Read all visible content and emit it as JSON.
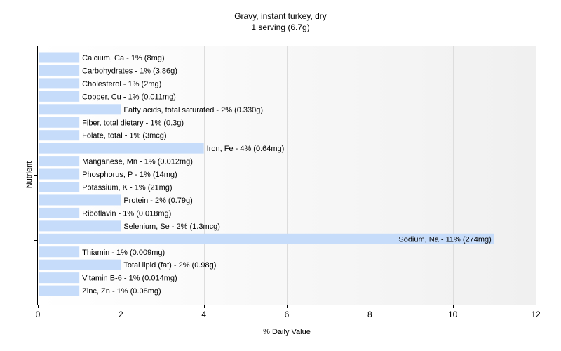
{
  "chart_data": {
    "type": "bar",
    "orientation": "horizontal",
    "title": "Gravy, instant turkey, dry",
    "subtitle": "1 serving (6.7g)",
    "xlabel": "% Daily Value",
    "ylabel": "Nutrient",
    "xlim": [
      0,
      12
    ],
    "xticks": [
      0,
      2,
      4,
      6,
      8,
      10,
      12
    ],
    "grid": true,
    "bar_color": "#c6dcfa",
    "categories": [
      "Calcium, Ca",
      "Carbohydrates",
      "Cholesterol",
      "Copper, Cu",
      "Fatty acids, total saturated",
      "Fiber, total dietary",
      "Folate, total",
      "Iron, Fe",
      "Manganese, Mn",
      "Phosphorus, P",
      "Potassium, K",
      "Protein",
      "Riboflavin",
      "Selenium, Se",
      "Sodium, Na",
      "Thiamin",
      "Total lipid (fat)",
      "Vitamin B-6",
      "Zinc, Zn"
    ],
    "values": [
      1,
      1,
      1,
      1,
      2,
      1,
      1,
      4,
      1,
      1,
      1,
      2,
      1,
      2,
      11,
      1,
      2,
      1,
      1
    ],
    "labels": [
      "Calcium, Ca - 1% (8mg)",
      "Carbohydrates - 1% (3.86g)",
      "Cholesterol - 1% (2mg)",
      "Copper, Cu - 1% (0.011mg)",
      "Fatty acids, total saturated - 2% (0.330g)",
      "Fiber, total dietary - 1% (0.3g)",
      "Folate, total - 1% (3mcg)",
      "Iron, Fe - 4% (0.64mg)",
      "Manganese, Mn - 1% (0.012mg)",
      "Phosphorus, P - 1% (14mg)",
      "Potassium, K - 1% (21mg)",
      "Protein - 2% (0.79g)",
      "Riboflavin - 1% (0.018mg)",
      "Selenium, Se - 2% (1.3mcg)",
      "Sodium, Na - 11% (274mg)",
      "Thiamin - 1% (0.009mg)",
      "Total lipid (fat) - 2% (0.98g)",
      "Vitamin B-6 - 1% (0.014mg)",
      "Zinc, Zn - 1% (0.08mg)"
    ]
  }
}
